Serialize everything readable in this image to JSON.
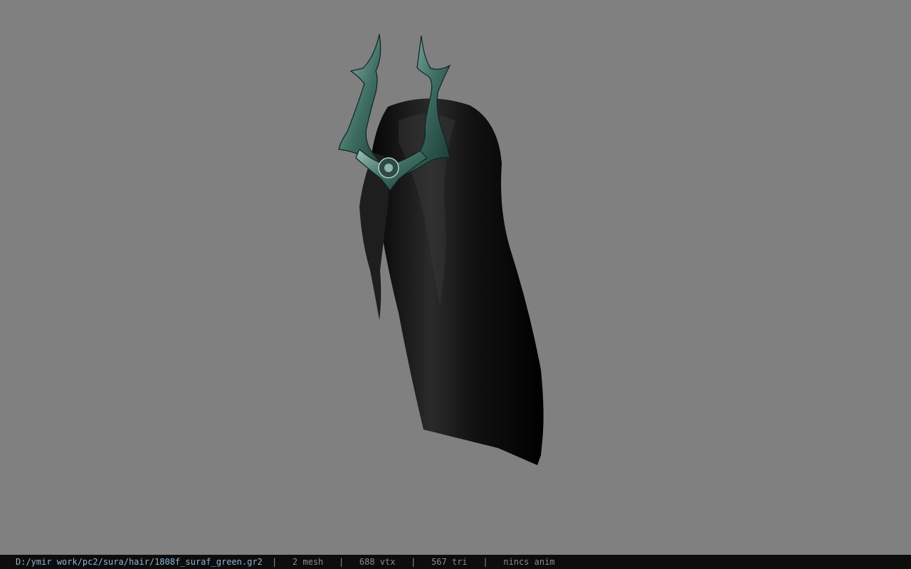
{
  "viewport": {
    "background_color": "#808080",
    "model": {
      "name": "hair-with-crown",
      "hair_color": "#0b0b0b",
      "crown_color": "#3f6e63"
    }
  },
  "statusbar": {
    "file_path": "D:/ymir work/pc2/sura/hair/1808f_suraf_green.gr2",
    "separator": "|",
    "mesh_count": "2 mesh",
    "vertex_count": "688 vtx",
    "triangle_count": "567 tri",
    "animation": "nincs anim",
    "path_color": "#8fb8d6",
    "text_color": "#8c8c8c"
  }
}
